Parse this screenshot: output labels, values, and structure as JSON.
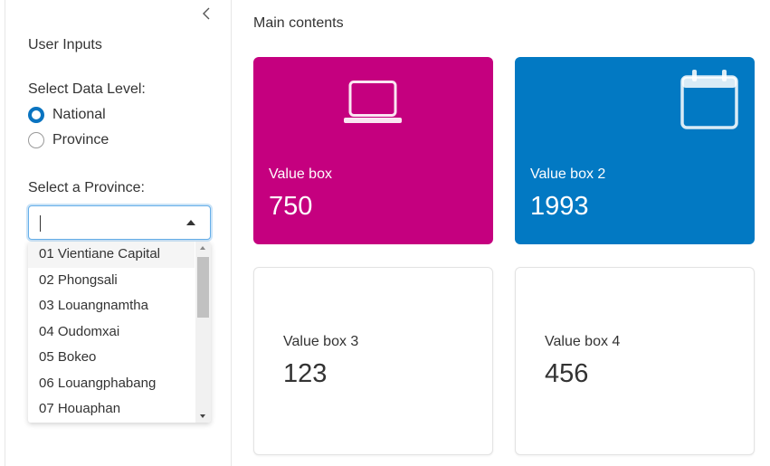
{
  "sidebar": {
    "collapse_icon": "chevron-left-icon",
    "title": "User Inputs",
    "data_level": {
      "label": "Select Data Level:",
      "options": [
        {
          "label": "National",
          "checked": true
        },
        {
          "label": "Province",
          "checked": false
        }
      ]
    },
    "province": {
      "label": "Select a Province:",
      "value": "",
      "options": [
        "01 Vientiane Capital",
        "02 Phongsali",
        "03 Louangnamtha",
        "04 Oudomxai",
        "05 Bokeo",
        "06 Louangphabang",
        "07 Houaphan"
      ],
      "highlighted": "01 Vientiane Capital"
    }
  },
  "main": {
    "title": "Main contents",
    "value_boxes": [
      {
        "title": "Value box",
        "value": "750",
        "color": "#c5007f",
        "icon": "laptop-icon"
      },
      {
        "title": "Value box 2",
        "value": "1993",
        "color": "#0279c3",
        "icon": "calendar-icon"
      },
      {
        "title": "Value box 3",
        "value": "123"
      },
      {
        "title": "Value box 4",
        "value": "456"
      }
    ]
  }
}
